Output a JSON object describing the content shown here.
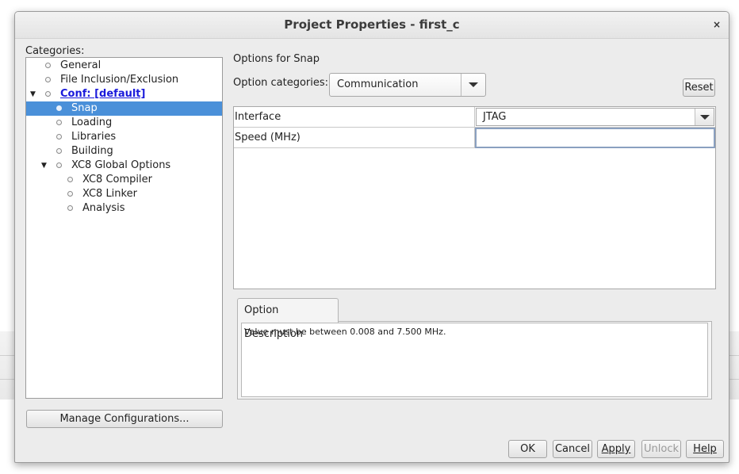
{
  "dialog": {
    "title": "Project Properties - first_c",
    "close_glyph": "×"
  },
  "categories": {
    "label": "Categories:",
    "items": [
      {
        "label": "General"
      },
      {
        "label": "File Inclusion/Exclusion"
      },
      {
        "label": "Conf: [default]"
      },
      {
        "label": "Snap"
      },
      {
        "label": "Loading"
      },
      {
        "label": "Libraries"
      },
      {
        "label": "Building"
      },
      {
        "label": "XC8 Global Options"
      },
      {
        "label": "XC8 Compiler"
      },
      {
        "label": "XC8 Linker"
      },
      {
        "label": "Analysis"
      }
    ],
    "selected": "Snap"
  },
  "manage_button": {
    "label": "Manage Configurations..."
  },
  "options": {
    "title": "Options for Snap",
    "category_label": "Option categories:",
    "category_value": "Communication",
    "reset_label": "Reset"
  },
  "properties": [
    {
      "name": "Interface",
      "value": "JTAG"
    },
    {
      "name": "Speed (MHz)",
      "value": ""
    }
  ],
  "description": {
    "tab_label": "Option Description",
    "text": "Value must be between 0.008 and 7.500 MHz."
  },
  "buttons": {
    "ok": "OK",
    "cancel": "Cancel",
    "apply": "Apply",
    "unlock": "Unlock",
    "help": "Help"
  },
  "colors": {
    "selection": "#4a90d9",
    "link": "#1a1adb"
  }
}
